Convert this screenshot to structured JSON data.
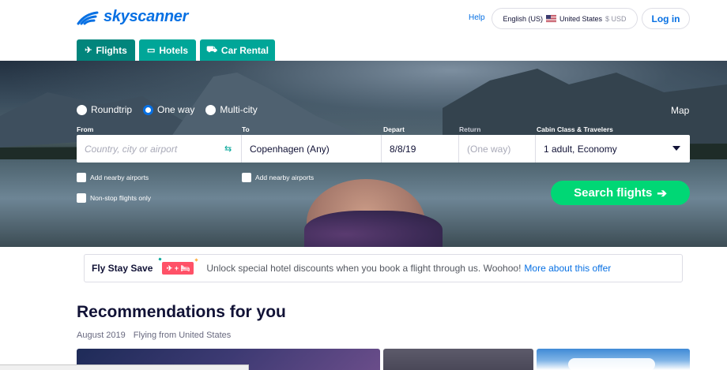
{
  "header": {
    "logo_text": "skyscanner",
    "help_label": "Help",
    "locale_language": "English (US)",
    "locale_country": "United States",
    "locale_currency": "$ USD",
    "login_label": "Log in"
  },
  "tabs": [
    {
      "label": "Flights",
      "icon": "plane-icon",
      "active": true
    },
    {
      "label": "Hotels",
      "icon": "bed-icon",
      "active": false
    },
    {
      "label": "Car Rental",
      "icon": "car-icon",
      "active": false
    }
  ],
  "search": {
    "trip_types": [
      "Roundtrip",
      "One way",
      "Multi-city"
    ],
    "selected_trip_type": "One way",
    "map_label": "Map",
    "labels": {
      "from": "From",
      "to": "To",
      "depart": "Depart",
      "return": "Return",
      "cabin": "Cabin Class & Travelers"
    },
    "from_placeholder": "Country, city or airport",
    "to_value": "Copenhagen (Any)",
    "depart_value": "8/8/19",
    "return_placeholder": "(One way)",
    "cabin_value": "1 adult, Economy",
    "nearby_from_label": "Add nearby airports",
    "nearby_to_label": "Add nearby airports",
    "nonstop_label": "Non-stop flights only",
    "search_button": "Search flights"
  },
  "promo": {
    "title": "Fly Stay Save",
    "badge": "✈ + 🛏",
    "description": "Unlock special hotel discounts when you book a flight through us. Woohoo!",
    "link": "More about this offer"
  },
  "recommendations": {
    "title": "Recommendations for you",
    "month": "August 2019",
    "origin": "Flying from United States"
  },
  "colors": {
    "brand_blue": "#0770e3",
    "tab_teal": "#00a698",
    "cta_green": "#00d775",
    "promo_red": "#ff5167"
  }
}
